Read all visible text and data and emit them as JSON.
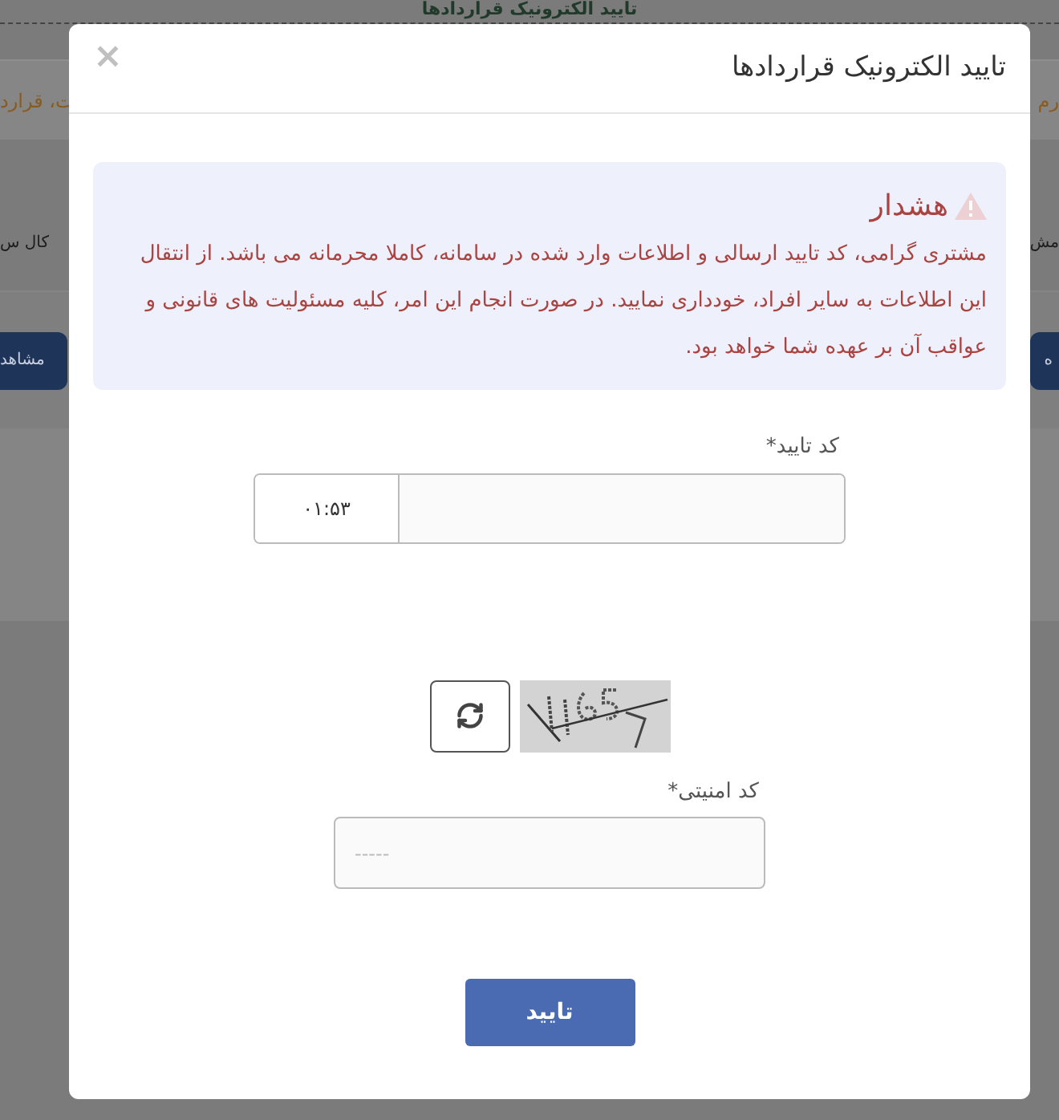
{
  "background": {
    "title": "تایید الکترونیک قراردادها",
    "notice_left": "ت، قرارد",
    "notice_right": "رم",
    "heading_left": "کال س",
    "heading_right": "مش",
    "button_left": "مشاهد",
    "button_right": "ه"
  },
  "modal": {
    "title": "تایید الکترونیک قراردادها",
    "close": "×",
    "alert": {
      "title": "هشدار",
      "text": "مشتری گرامی، کد تایید ارسالی و اطلاعات وارد شده در سامانه، کاملا محرمانه می باشد. از انتقال این اطلاعات به سایر افراد، خودداری نمایید. در صورت انجام این امر، کلیه مسئولیت های قانونی و عواقب آن بر عهده شما خواهد بود."
    },
    "verification": {
      "label": "کد تایید*",
      "timer": "۰۱:۵۳"
    },
    "security": {
      "label": "کد امنیتی*",
      "placeholder": "-----"
    },
    "submit": "تایید"
  }
}
